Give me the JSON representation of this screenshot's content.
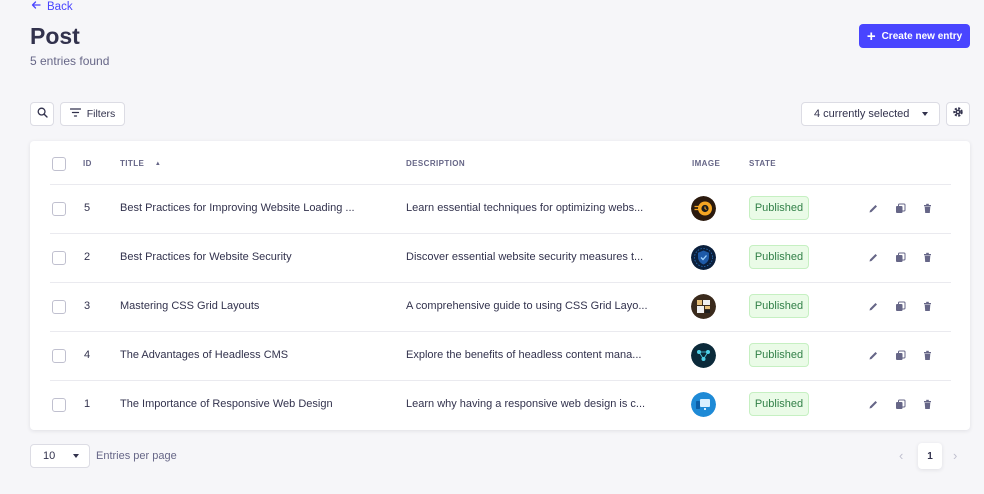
{
  "header": {
    "back_label": "Back",
    "title": "Post",
    "subtitle": "5 entries found",
    "create_label": "Create new entry"
  },
  "toolbar": {
    "filters_label": "Filters",
    "columns_select_value": "4 currently selected"
  },
  "table": {
    "columns": {
      "id": "ID",
      "title": "TITLE",
      "description": "DESCRIPTION",
      "image": "IMAGE",
      "state": "STATE"
    },
    "sort_indicator": "▲",
    "rows": [
      {
        "id": "5",
        "title": "Best Practices for Improving Website Loading ...",
        "description": "Learn essential techniques for optimizing webs...",
        "state": "Published",
        "thumb_icon": "clock-speed-icon"
      },
      {
        "id": "2",
        "title": "Best Practices for Website Security",
        "description": "Discover essential website security measures t...",
        "state": "Published",
        "thumb_icon": "security-shield-icon"
      },
      {
        "id": "3",
        "title": "Mastering CSS Grid Layouts",
        "description": "A comprehensive guide to using CSS Grid Layo...",
        "state": "Published",
        "thumb_icon": "grid-layout-icon"
      },
      {
        "id": "4",
        "title": "The Advantages of Headless CMS",
        "description": "Explore the benefits of headless content mana...",
        "state": "Published",
        "thumb_icon": "network-nodes-icon"
      },
      {
        "id": "1",
        "title": "The Importance of Responsive Web Design",
        "description": "Learn why having a responsive web design is c...",
        "state": "Published",
        "thumb_icon": "devices-icon"
      }
    ]
  },
  "pagination": {
    "per_page_value": "10",
    "per_page_label": "Entries per page",
    "prev_glyph": "‹",
    "next_glyph": "›",
    "current_page": "1"
  },
  "colors": {
    "primary": "#4945ff",
    "published_bg": "#eafbe7",
    "published_text": "#328048"
  }
}
